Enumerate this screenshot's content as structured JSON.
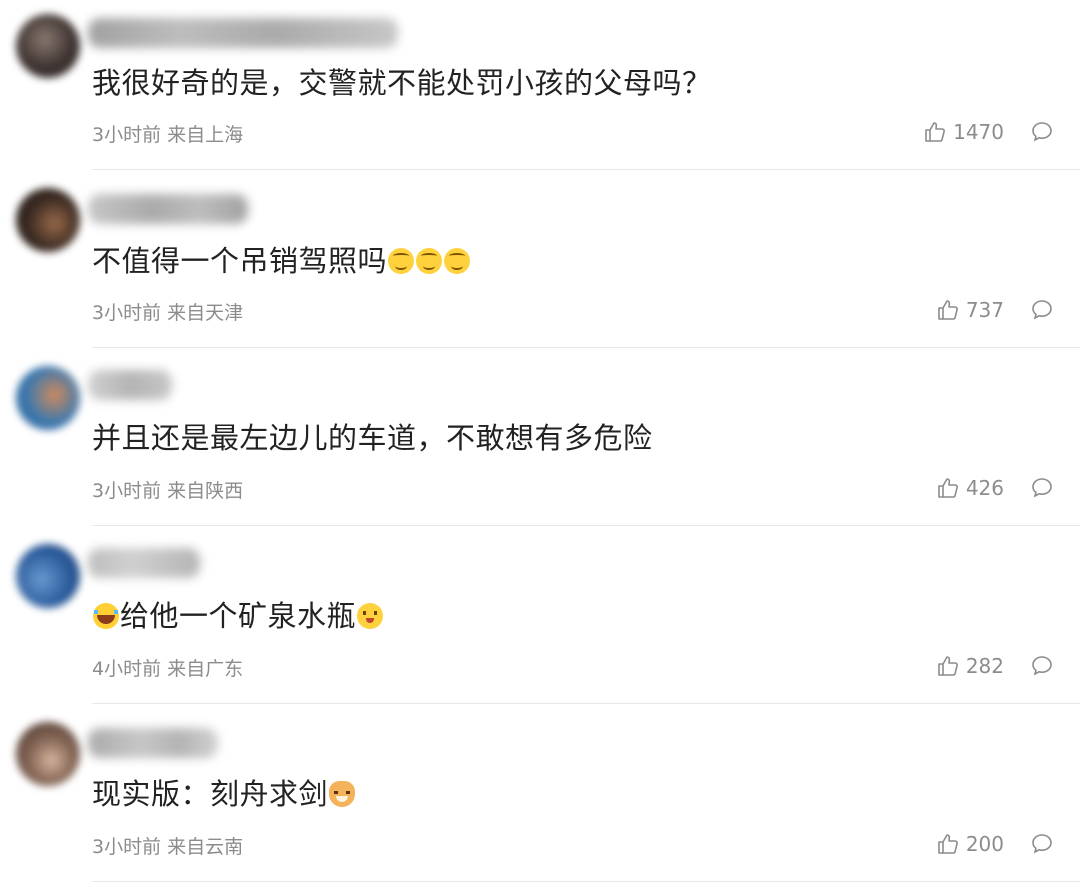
{
  "comments": [
    {
      "text": "我很好奇的是，交警就不能处罚小孩的父母吗？",
      "emojis_before": [],
      "emojis_after": [],
      "time": "3小时前",
      "location": "来自上海",
      "likes": "1470",
      "avatar_colors": [
        "#3d3230",
        "#8a7a70"
      ],
      "username_color": "#6a6a6a"
    },
    {
      "text": "不值得一个吊销驾照吗",
      "emojis_before": [],
      "emojis_after": [
        "sweat-smile-icon",
        "sweat-smile-icon",
        "sweat-smile-icon"
      ],
      "time": "3小时前",
      "location": "来自天津",
      "likes": "737",
      "avatar_colors": [
        "#2a2420",
        "#9a6a4a"
      ],
      "username_color": "#7a7a7a"
    },
    {
      "text": "并且还是最左边儿的车道，不敢想有多危险",
      "emojis_before": [],
      "emojis_after": [],
      "time": "3小时前",
      "location": "来自陕西",
      "likes": "426",
      "avatar_colors": [
        "#3a78b0",
        "#d08a5a"
      ],
      "username_color": "#9a9a9a"
    },
    {
      "text": "给他一个矿泉水瓶",
      "emojis_before": [
        "laughing-tears-icon"
      ],
      "emojis_after": [
        "smiling-face-icon"
      ],
      "time": "4小时前",
      "location": "来自广东",
      "likes": "282",
      "avatar_colors": [
        "#2a5a9a",
        "#6a9ad0"
      ],
      "username_color": "#8a8a8a"
    },
    {
      "text": "现实版：刻舟求剑",
      "emojis_before": [],
      "emojis_after": [
        "cat-face-icon"
      ],
      "time": "3小时前",
      "location": "来自云南",
      "likes": "200",
      "avatar_colors": [
        "#3a2a22",
        "#d8b8a0"
      ],
      "username_color": "#7a7a7a"
    }
  ]
}
